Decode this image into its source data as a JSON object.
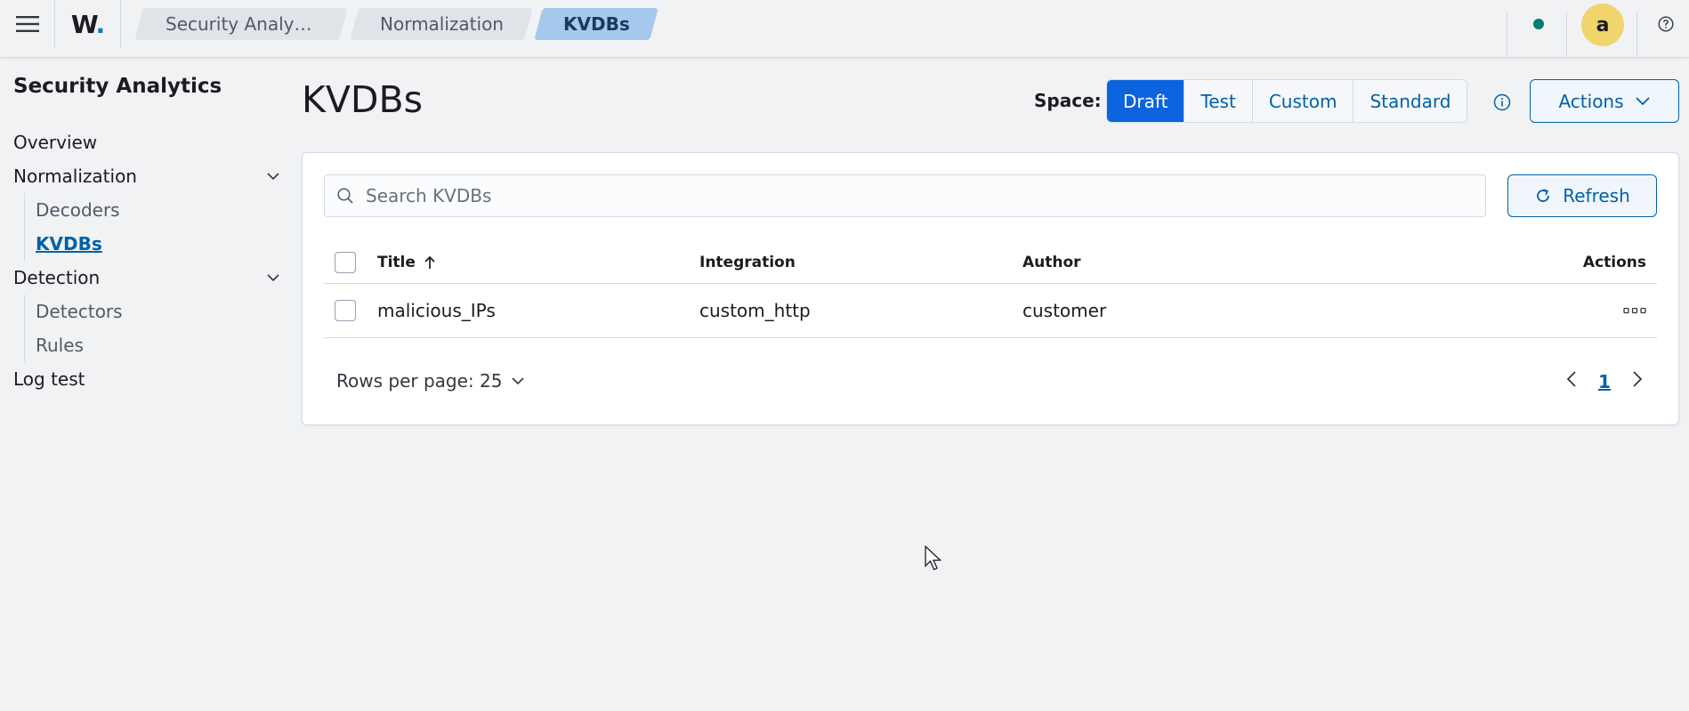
{
  "header": {
    "logo": "W",
    "breadcrumbs": [
      "Security Analytics",
      "Normalization",
      "KVDBs"
    ],
    "avatar_letter": "a",
    "colors": {
      "accent": "#0b64dd",
      "status": "#017d73",
      "avatar": "#f0d56c"
    }
  },
  "sidebar": {
    "title": "Security Analytics",
    "items": [
      {
        "label": "Overview"
      },
      {
        "label": "Normalization",
        "expandable": true,
        "children": [
          {
            "label": "Decoders"
          },
          {
            "label": "KVDBs",
            "active": true
          }
        ]
      },
      {
        "label": "Detection",
        "expandable": true,
        "children": [
          {
            "label": "Detectors"
          },
          {
            "label": "Rules"
          }
        ]
      },
      {
        "label": "Log test"
      }
    ]
  },
  "main": {
    "title": "KVDBs",
    "space": {
      "label": "Space:",
      "options": [
        "Draft",
        "Test",
        "Custom",
        "Standard"
      ],
      "selected": "Draft"
    },
    "actions_label": "Actions",
    "search": {
      "placeholder": "Search KVDBs",
      "value": ""
    },
    "refresh_label": "Refresh",
    "table": {
      "columns": [
        "Title",
        "Integration",
        "Author",
        "Actions"
      ],
      "sort": {
        "column": "Title",
        "direction": "ascending"
      },
      "rows": [
        {
          "title": "malicious_IPs",
          "integration": "custom_http",
          "author": "customer"
        }
      ]
    },
    "pagination": {
      "rows_per_page_label": "Rows per page: 25",
      "current_page": "1"
    }
  }
}
